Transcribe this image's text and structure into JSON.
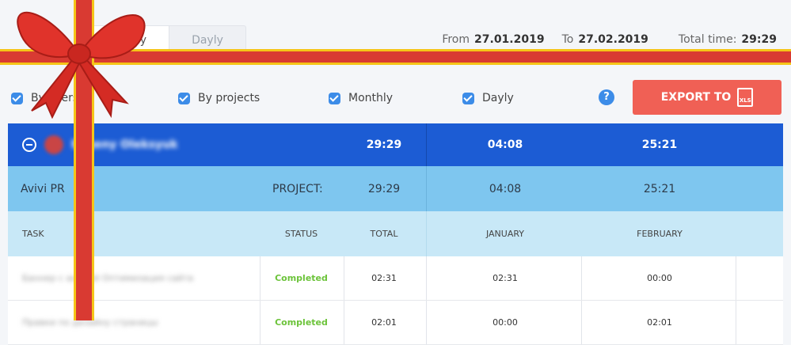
{
  "tabs": [
    {
      "label": "Monthly"
    },
    {
      "label": "Dayly"
    }
  ],
  "period": {
    "from_label": "From",
    "from": "27.01.2019",
    "to_label": "To",
    "to": "27.02.2019",
    "total_label": "Total time:",
    "total": "29:29"
  },
  "filters": [
    {
      "label": "By users"
    },
    {
      "label": "By projects"
    },
    {
      "label": "Monthly"
    },
    {
      "label": "Dayly"
    }
  ],
  "help_symbol": "?",
  "export": {
    "label": "EXPORT TO",
    "file_icon_text": "XLS"
  },
  "user_row": {
    "name": "Evgeny Oleksyuk",
    "total": "29:29",
    "jan": "04:08",
    "feb": "25:21"
  },
  "project_row": {
    "name": "Avivi PR",
    "label": "PROJECT:",
    "total": "29:29",
    "jan": "04:08",
    "feb": "25:21"
  },
  "headers": {
    "task": "TASK",
    "status": "STATUS",
    "total": "TOTAL",
    "jan": "JANUARY",
    "feb": "FEBRUARY"
  },
  "rows": [
    {
      "task": "Баннер с акцией Оптимизация сайта",
      "status": "Completed",
      "total": "02:31",
      "jan": "02:31",
      "feb": "00:00"
    },
    {
      "task": "Правки по дизайну страницы",
      "status": "Completed",
      "total": "02:01",
      "jan": "00:00",
      "feb": "02:01"
    }
  ],
  "colors": {
    "accent": "#3c8ce8",
    "user_row": "#1c5cd4",
    "project_row": "#7ec6ef",
    "header_row": "#c8e8f7",
    "export": "#f06055",
    "completed": "#6cc33a"
  }
}
